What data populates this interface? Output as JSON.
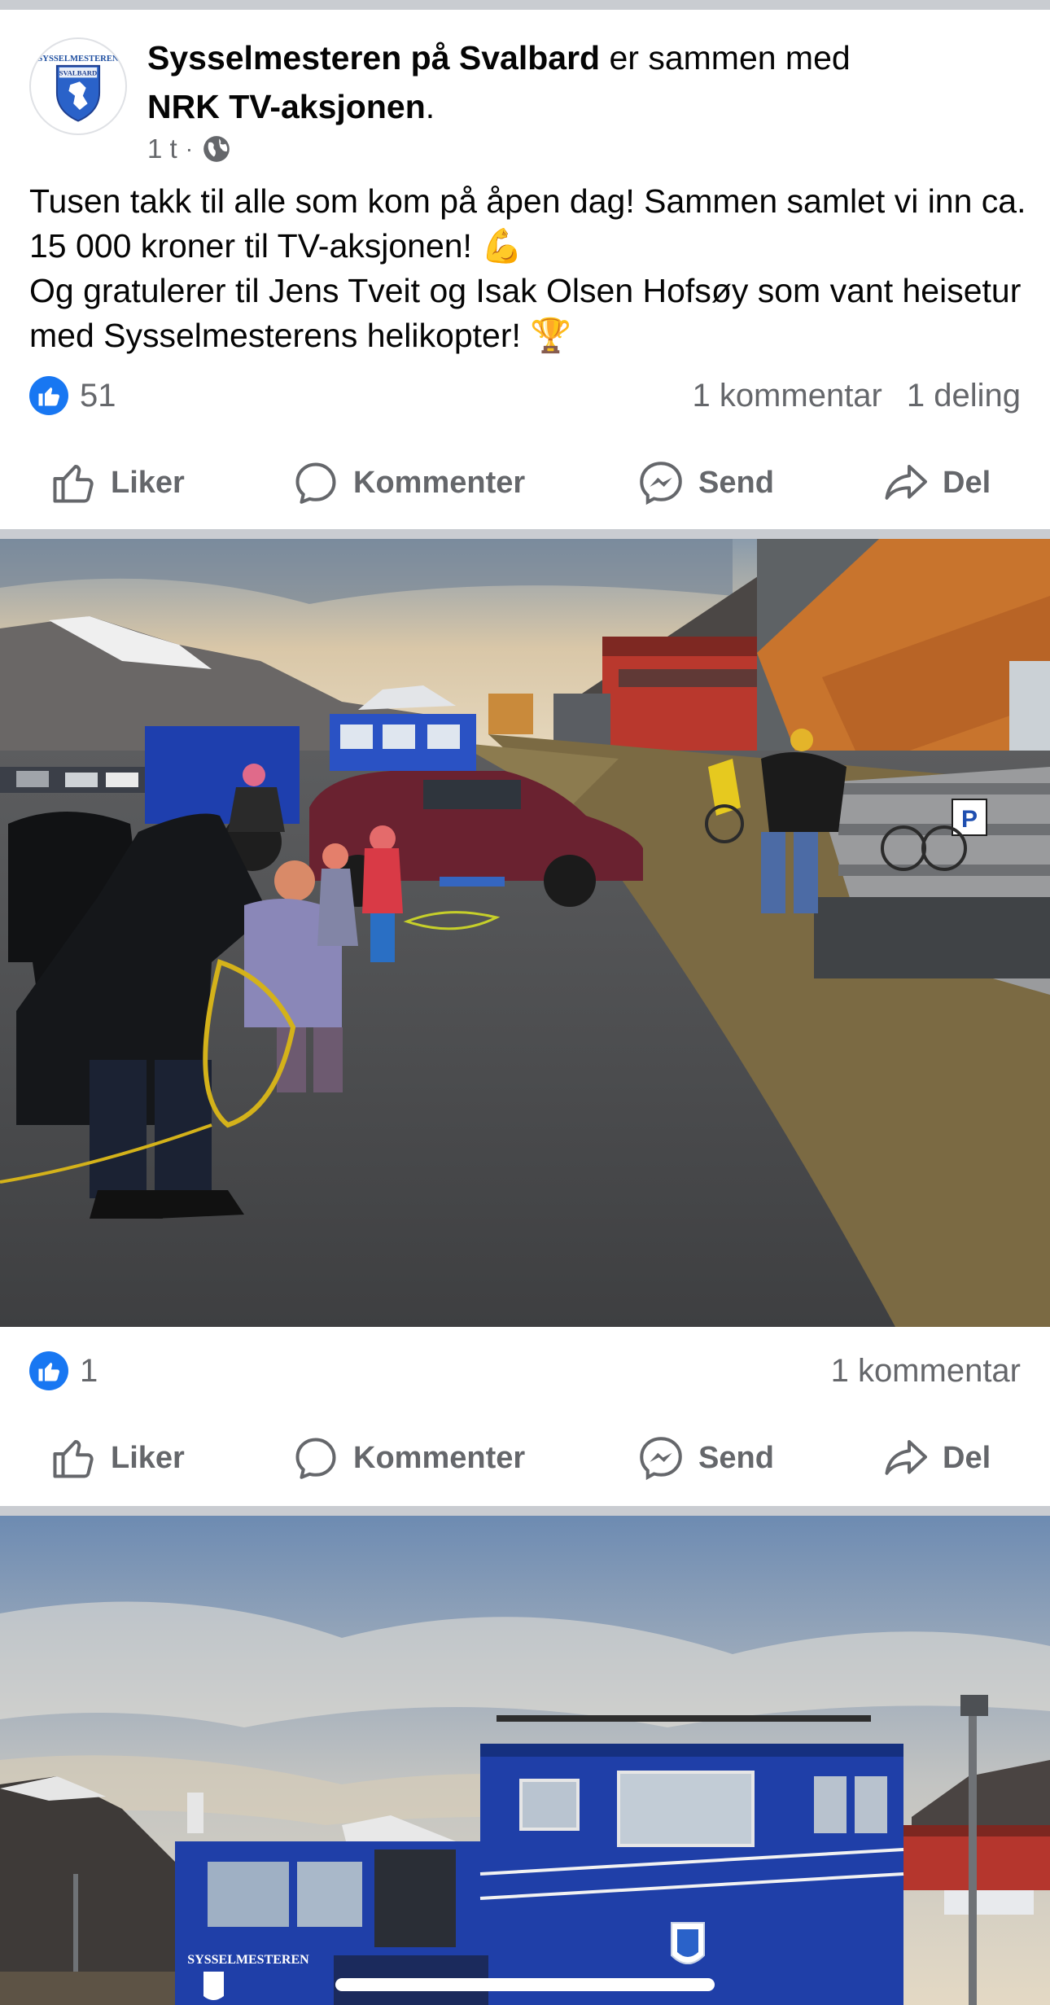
{
  "post": {
    "author": "Sysselmesteren på Svalbard",
    "with_text": " er sammen med",
    "tagged": "NRK TV-aksjonen",
    "tagged_suffix": ".",
    "time": "1 t",
    "separator": "·",
    "avatar_text_top": "SYSSELMESTEREN",
    "avatar_text_mid": "SVALBARD",
    "text_lines": [
      "Tusen takk til alle som kom på åpen dag! Sammen samlet vi inn ca. 15 000 kroner til TV-aksjonen! 💪",
      "Og gratulerer til Jens Tveit og Isak Olsen Hofsøy som vant heisetur med Sysselmesterens helikopter! 🏆"
    ],
    "likes": "51",
    "comments": "1 kommentar",
    "shares": "1 deling"
  },
  "actions": {
    "like": "Liker",
    "comment": "Kommenter",
    "send": "Send",
    "share": "Del"
  },
  "photo1": {
    "likes": "1",
    "comments": "1 kommentar",
    "sign_p": "P"
  },
  "photo2": {
    "vehicle_text": "SYSSELMESTEREN"
  },
  "colors": {
    "facebook_blue": "#1877f2",
    "secondary_text": "#65676b",
    "divider": "#c9ccd1",
    "vehicle_blue": "#1f3fa8"
  }
}
